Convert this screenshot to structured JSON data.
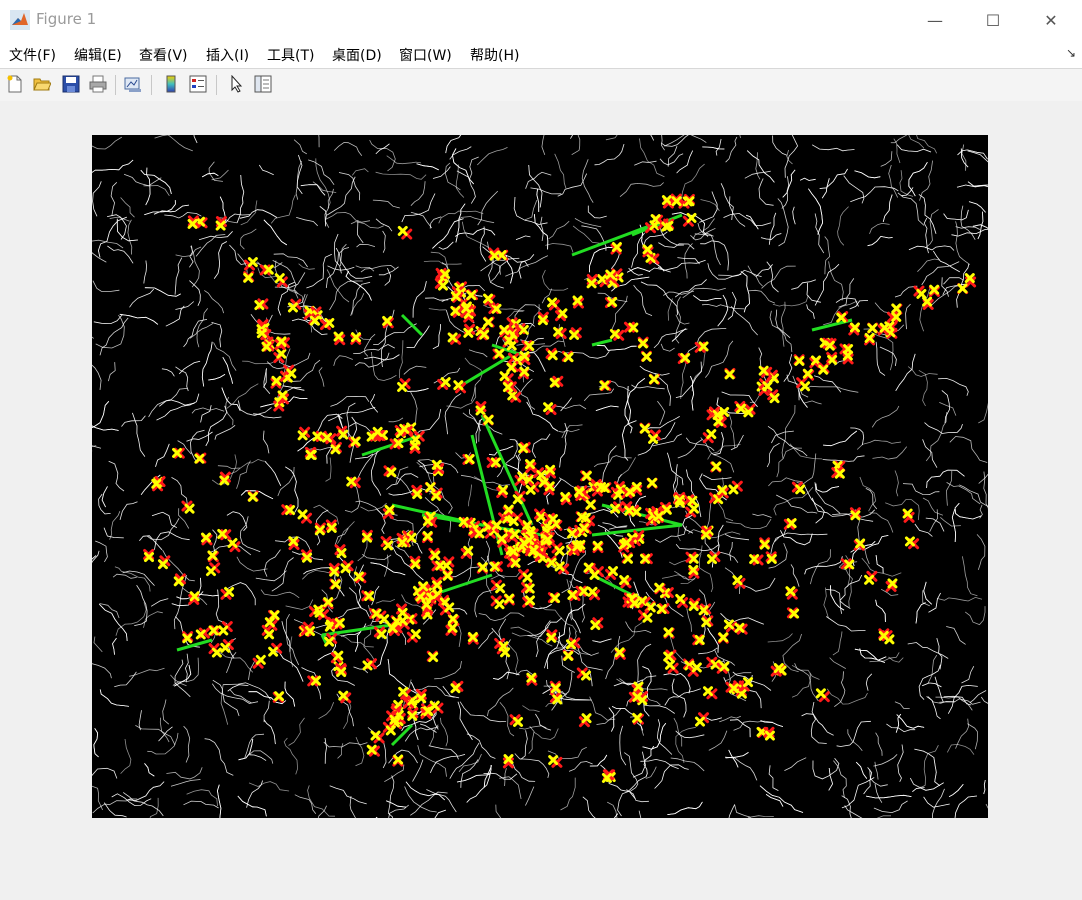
{
  "window": {
    "title": "Figure 1",
    "controls": {
      "minimize": "—",
      "maximize": "☐",
      "close": "✕"
    }
  },
  "menubar": {
    "items": [
      {
        "id": "file",
        "label": "文件(F)"
      },
      {
        "id": "edit",
        "label": "编辑(E)"
      },
      {
        "id": "view",
        "label": "查看(V)"
      },
      {
        "id": "insert",
        "label": "插入(I)"
      },
      {
        "id": "tools",
        "label": "工具(T)"
      },
      {
        "id": "desktop",
        "label": "桌面(D)"
      },
      {
        "id": "window",
        "label": "窗口(W)"
      },
      {
        "id": "help",
        "label": "帮助(H)"
      }
    ],
    "dock_arrow": "↘"
  },
  "toolbar": {
    "buttons": [
      {
        "id": "new",
        "icon": "new-figure-icon"
      },
      {
        "id": "open",
        "icon": "open-file-icon"
      },
      {
        "id": "save",
        "icon": "save-icon"
      },
      {
        "id": "print",
        "icon": "print-icon"
      },
      {
        "id": "link",
        "icon": "link-plot-icon"
      },
      {
        "id": "colorbar",
        "icon": "colorbar-icon"
      },
      {
        "id": "legend",
        "icon": "legend-icon"
      },
      {
        "id": "edit",
        "icon": "edit-plot-arrow-icon"
      },
      {
        "id": "browser",
        "icon": "plot-browser-icon"
      }
    ]
  },
  "plot": {
    "background": "#000000",
    "edge_color": "#ffffff",
    "marker_red": "#ff1a1a",
    "marker_yellow": "#ffff00",
    "line_color": "#22dd22"
  }
}
